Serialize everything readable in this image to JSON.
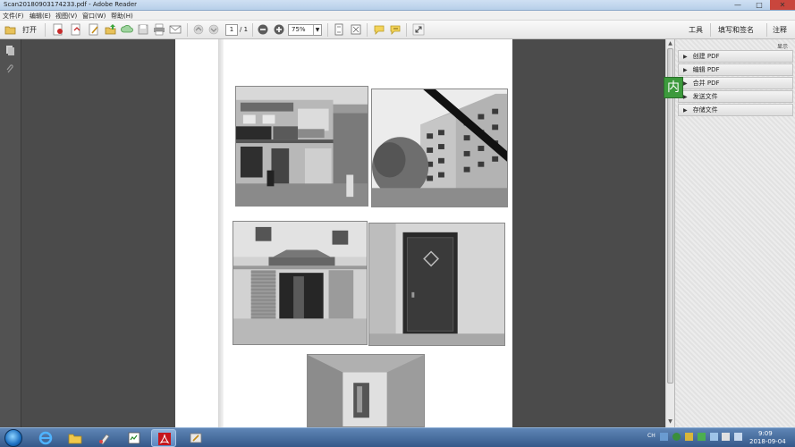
{
  "window": {
    "title": "Scan20180903174233.pdf - Adobe Reader",
    "min_glyph": "—",
    "max_glyph": "□",
    "close_glyph": "✕"
  },
  "menu": [
    "文件(F)",
    "编辑(E)",
    "视图(V)",
    "窗口(W)",
    "帮助(H)"
  ],
  "toolbar": {
    "open_label": "打开",
    "page_current": "1",
    "page_total": "/ 1",
    "zoom": "75%",
    "tools_label": "工具",
    "fill_sign_label": "填写和签名",
    "comment_label": "注释",
    "icons": [
      "open-folder-icon",
      "pdf-create-icon",
      "pdf-export-icon",
      "edit-icon",
      "upload-icon",
      "cloud-icon",
      "save-icon",
      "print-icon",
      "email-icon",
      "prev-page-icon",
      "next-page-icon",
      "zoom-out-icon",
      "zoom-in-icon",
      "fit-page-icon",
      "full-screen-icon",
      "comment-icon",
      "highlight-icon",
      "expand-icon"
    ]
  },
  "right_panel": {
    "hide_label": "显示",
    "items": [
      {
        "label": "创建 PDF"
      },
      {
        "label": "编辑 PDF"
      },
      {
        "label": "合并 PDF"
      },
      {
        "label": "发送文件"
      },
      {
        "label": "存储文件"
      }
    ]
  },
  "ime_badge": "内",
  "taskbar": {
    "apps": [
      "ie-icon",
      "explorer-folder-icon",
      "paint-icon",
      "task-manager-icon",
      "adobe-reader-icon",
      "paintbrush-icon"
    ],
    "lang": "CH",
    "time": "9:09",
    "date": "2018-09-04"
  }
}
